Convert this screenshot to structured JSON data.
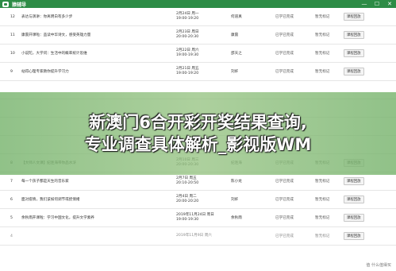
{
  "window": {
    "title": "猿辅导",
    "minimize": "—",
    "maximize": "☐",
    "close": "✕"
  },
  "rows": [
    {
      "num": "12",
      "title": "表达与演讲：你离明白有多少步",
      "date": "2月24日 周一",
      "time": "19:00-19:20",
      "teacher": "何道真",
      "status": "已学已完成",
      "attach": "暂无标记",
      "action": "课程回放"
    },
    {
      "num": "11",
      "title": "康震开课啦：品读中华诗文，感受英雄力量",
      "date": "2月23日 周日",
      "time": "20:00-20:30",
      "teacher": "康震",
      "status": "已学已完成",
      "attach": "暂无标记",
      "action": "课程回放"
    },
    {
      "num": "10",
      "title": "小说陀，大学问：生活中的概率统计思维",
      "date": "2月22日 周六",
      "time": "19:00-19:30",
      "teacher": "邵天之",
      "status": "已学已完成",
      "attach": "暂无标记",
      "action": "课程回放"
    },
    {
      "num": "9",
      "title": "站得心理专家教你提升学习力",
      "date": "2月21日 周五",
      "time": "19:00-19:20",
      "teacher": "刘奸",
      "status": "已学已完成",
      "attach": "暂无标记",
      "action": "课程回放"
    },
    {
      "num": "8",
      "title": "【大师人文课】纪连海带你品水浒",
      "date": "2月10日 周三",
      "time": "20:00-20:30",
      "teacher": "纪连海",
      "status": "已学已完成",
      "attach": "暂无标记",
      "action": "课程回放"
    },
    {
      "num": "7",
      "title": "每一个孩子都是天生的音乐家",
      "date": "2月7日 周五",
      "time": "20:10-20:50",
      "teacher": "陈小龙",
      "status": "已学已完成",
      "attach": "暂无标记",
      "action": "课程回放"
    },
    {
      "num": "6",
      "title": "面对疫情，我们该如何调节或抚情绪",
      "date": "2月4日 周二",
      "time": "20:00-20:20",
      "teacher": "刘奸",
      "status": "已学已完成",
      "attach": "暂无标记",
      "action": "课程回放"
    },
    {
      "num": "5",
      "title": "余秋雨开课啦：学习中国文化，提升文学素养",
      "date": "2019年11月24日 周日",
      "time": "19:00-19:30",
      "teacher": "余秋雨",
      "status": "已学已完成",
      "attach": "暂无标记",
      "action": "课程回放"
    },
    {
      "num": "4",
      "title": "",
      "date": "2019年11月9日 周六",
      "time": "",
      "teacher": "",
      "status": "已学已完成",
      "attach": "暂无标记",
      "action": "课程回放"
    }
  ],
  "banner": {
    "line1": "新澳门6合开彩开奖结果查询,",
    "line2": "专业调查具体解析_影视版WM"
  },
  "watermark": {
    "text": "值 什么值得买"
  }
}
